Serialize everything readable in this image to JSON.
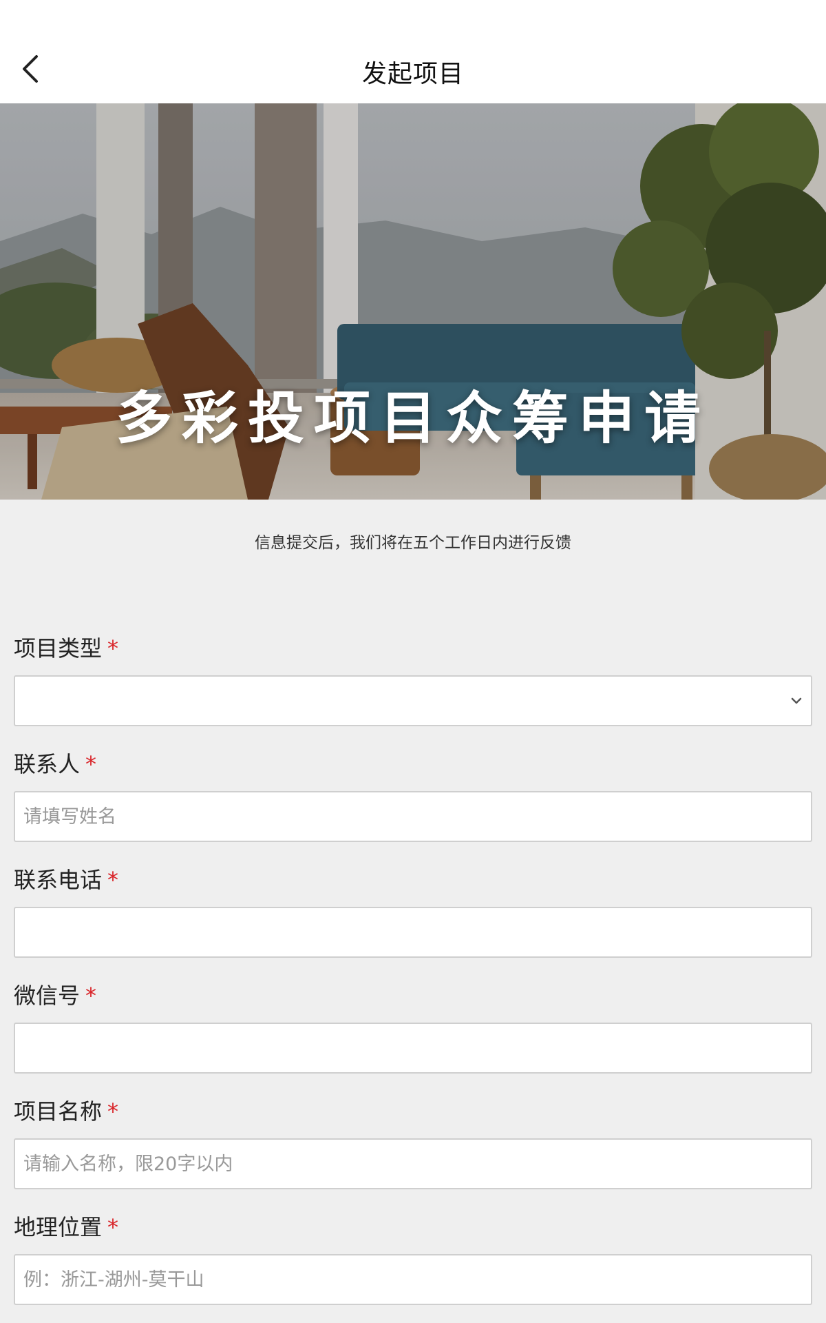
{
  "header": {
    "title": "发起项目"
  },
  "banner": {
    "title": "多彩投项目众筹申请"
  },
  "notice": "信息提交后，我们将在五个工作日内进行反馈",
  "required_mark": "*",
  "form": {
    "project_type": {
      "label": "项目类型",
      "value": ""
    },
    "contact_name": {
      "label": "联系人",
      "placeholder": "请填写姓名"
    },
    "contact_phone": {
      "label": "联系电话",
      "placeholder": ""
    },
    "wechat": {
      "label": "微信号",
      "placeholder": ""
    },
    "project_name": {
      "label": "项目名称",
      "placeholder": "请输入名称，限20字以内"
    },
    "location": {
      "label": "地理位置",
      "placeholder": "例：浙江-湖州-莫干山"
    }
  },
  "colors": {
    "required": "#d9252a",
    "page_bg": "#efefef",
    "border": "#cfcfcf"
  }
}
